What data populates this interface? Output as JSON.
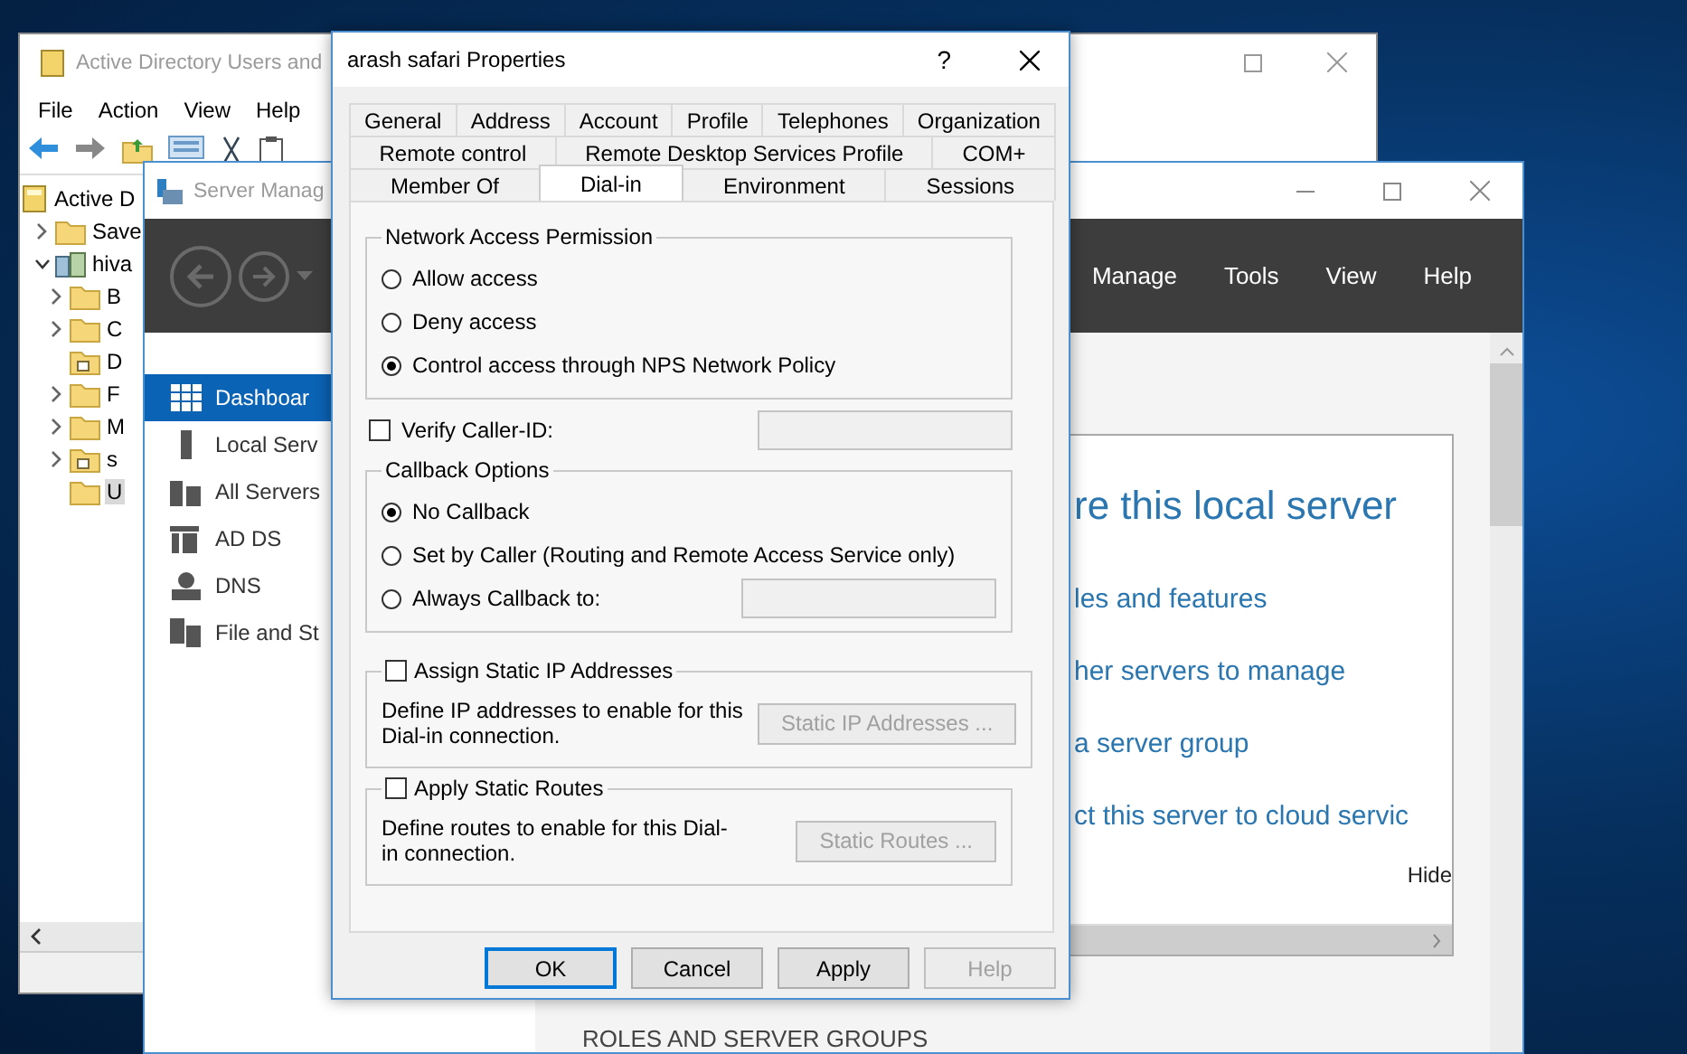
{
  "ad_window": {
    "title": "Active Directory Users and",
    "menu": [
      "File",
      "Action",
      "View",
      "Help"
    ],
    "tree": [
      {
        "label": "Active D",
        "kind": "root",
        "has_toggle": false,
        "selected": false,
        "children": [
          {
            "label": "Save",
            "kind": "folder",
            "has_toggle": true,
            "expanded": false,
            "selected": false
          },
          {
            "label": "hiva",
            "kind": "domain",
            "has_toggle": true,
            "expanded": true,
            "selected": false,
            "children": [
              {
                "label": "B",
                "kind": "folder",
                "has_toggle": true,
                "expanded": false,
                "selected": false
              },
              {
                "label": "C",
                "kind": "folder",
                "has_toggle": true,
                "expanded": false,
                "selected": false
              },
              {
                "label": "D",
                "kind": "ou",
                "has_toggle": false,
                "selected": false
              },
              {
                "label": "F",
                "kind": "folder",
                "has_toggle": true,
                "expanded": false,
                "selected": false
              },
              {
                "label": "M",
                "kind": "folder",
                "has_toggle": true,
                "expanded": false,
                "selected": false
              },
              {
                "label": "s",
                "kind": "ou",
                "has_toggle": true,
                "expanded": false,
                "selected": false
              },
              {
                "label": "U",
                "kind": "folder",
                "has_toggle": false,
                "selected": true
              }
            ]
          }
        ]
      }
    ]
  },
  "server_manager": {
    "title": "Server Manag",
    "menu": [
      "Manage",
      "Tools",
      "View",
      "Help"
    ],
    "nav": [
      {
        "label": "Dashboar",
        "kind": "dashboard",
        "selected": true
      },
      {
        "label": "Local Serv",
        "kind": "server",
        "selected": false
      },
      {
        "label": "All Servers",
        "kind": "servers",
        "selected": false
      },
      {
        "label": "AD DS",
        "kind": "adds",
        "selected": false
      },
      {
        "label": "DNS",
        "kind": "dns",
        "selected": false
      },
      {
        "label": "File and St",
        "kind": "files",
        "selected": false
      }
    ],
    "card": {
      "heading": "re this local server",
      "links": [
        "les and features",
        "her servers to manage",
        "a server group",
        "ct this server to cloud servic"
      ],
      "hide": "Hide"
    },
    "section": "ROLES AND SERVER GROUPS"
  },
  "dialog": {
    "title": "arash safari Properties",
    "help_glyph": "?",
    "tab_rows": [
      [
        {
          "label": "General",
          "selected": false
        },
        {
          "label": "Address",
          "selected": false
        },
        {
          "label": "Account",
          "selected": false
        },
        {
          "label": "Profile",
          "selected": false
        },
        {
          "label": "Telephones",
          "selected": false
        },
        {
          "label": "Organization",
          "selected": false
        }
      ],
      [
        {
          "label": "Remote control",
          "selected": false
        },
        {
          "label": "Remote Desktop Services Profile",
          "selected": false
        },
        {
          "label": "COM+",
          "selected": false
        }
      ],
      [
        {
          "label": "Member Of",
          "selected": false
        },
        {
          "label": "Dial-in",
          "selected": true
        },
        {
          "label": "Environment",
          "selected": false
        },
        {
          "label": "Sessions",
          "selected": false
        }
      ]
    ],
    "network_access": {
      "title": "Network Access Permission",
      "options": [
        {
          "label": "Allow access",
          "selected": false
        },
        {
          "label": "Deny access",
          "selected": false
        },
        {
          "label": "Control access through NPS Network Policy",
          "selected": true
        }
      ]
    },
    "verify_caller_id": {
      "label": "Verify Caller-ID:",
      "checked": false,
      "field_disabled": true
    },
    "callback": {
      "title": "Callback Options",
      "options": [
        {
          "label": "No Callback",
          "selected": true,
          "kind": "plain"
        },
        {
          "label": "Set by Caller (Routing and Remote Access Service only)",
          "selected": false,
          "kind": "plain"
        },
        {
          "label": "Always Callback to:",
          "selected": false,
          "kind": "with_field"
        }
      ],
      "field_disabled": true
    },
    "static_groups": [
      {
        "label": "Assign Static IP Addresses",
        "checked": false,
        "description": "Define IP addresses to enable for this Dial-in connection.",
        "button": {
          "label": "Static IP Addresses ...",
          "disabled": true
        }
      },
      {
        "label": "Apply Static Routes",
        "checked": false,
        "description": "Define routes to enable for this Dial-in connection.",
        "button": {
          "label": "Static Routes ...",
          "disabled": true
        }
      }
    ],
    "buttons": [
      {
        "label": "OK",
        "default": true,
        "disabled": false
      },
      {
        "label": "Cancel",
        "default": false,
        "disabled": false
      },
      {
        "label": "Apply",
        "default": false,
        "disabled": false
      },
      {
        "label": "Help",
        "default": false,
        "disabled": true
      }
    ]
  }
}
